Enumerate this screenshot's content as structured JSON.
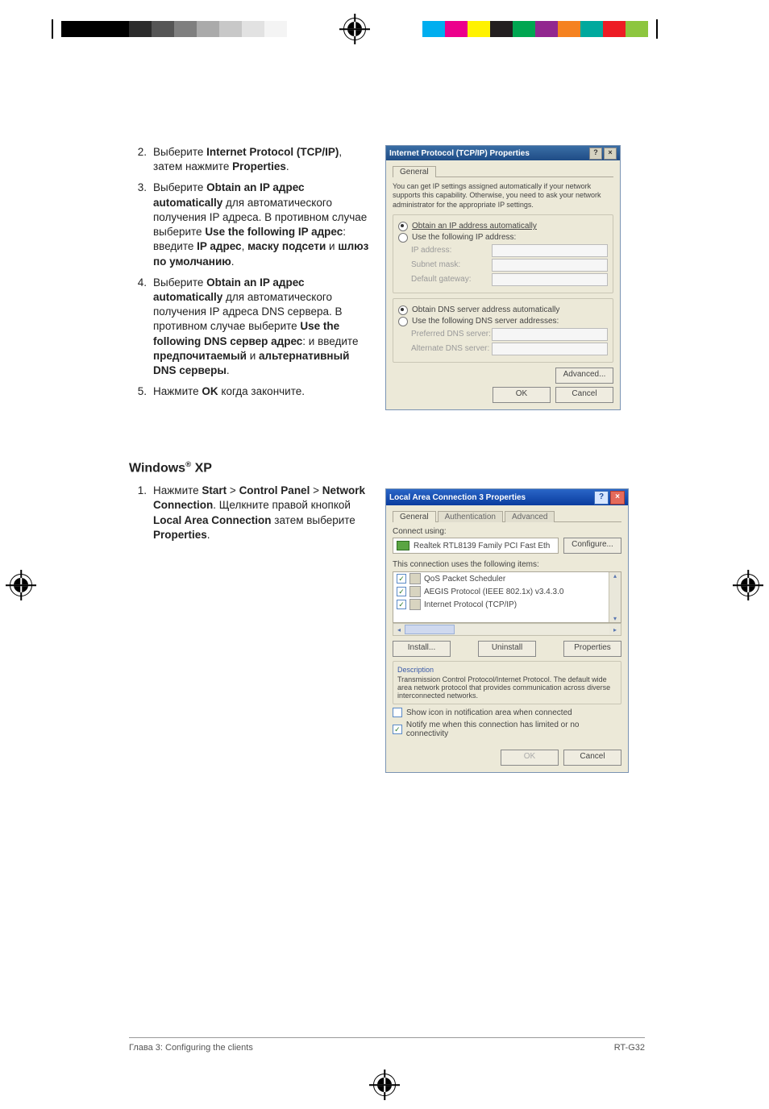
{
  "reg_colors_right": [
    "#00aeef",
    "#ec008c",
    "#fff200",
    "#231f20",
    "#00a651",
    "#92278f",
    "#f58220",
    "#00a99d",
    "#ed1c24",
    "#8dc63f"
  ],
  "reg_colors_left_count": 10,
  "steps_top": [
    {
      "num": "2.",
      "parts": [
        "Выберите ",
        [
          "b",
          "Internet Protocol (TCP/IP)"
        ],
        ", затем нажмите ",
        [
          "b",
          "Properties"
        ],
        "."
      ]
    },
    {
      "num": "3.",
      "parts": [
        "Выберите ",
        [
          "b",
          "Obtain an IP адрес automatically"
        ],
        " для автоматического получения IP адреса. В противном случае выберите ",
        [
          "b",
          "Use the following IP адрес"
        ],
        ": введите ",
        [
          "b",
          "IP адрес"
        ],
        ", ",
        [
          "b",
          "маску подсети"
        ],
        " и ",
        [
          "b",
          "шлюз по умолчанию"
        ],
        "."
      ]
    },
    {
      "num": "4.",
      "parts": [
        "Выберите ",
        [
          "b",
          "Obtain an IP адрес automatically"
        ],
        " для автоматического получения IP адреса DNS сервера. В противном случае выберите ",
        [
          "b",
          "Use the following DNS сервер адрес"
        ],
        ": и введите ",
        [
          "b",
          "предпочитаемый"
        ],
        " и ",
        [
          "b",
          "альтернативный DNS серверы"
        ],
        "."
      ]
    },
    {
      "num": "5.",
      "parts": [
        "Нажмите ",
        [
          "b",
          "OK"
        ],
        " когда закончите."
      ]
    }
  ],
  "section_heading_parts": [
    [
      "b",
      "Windows"
    ],
    [
      "sup",
      "®"
    ],
    [
      "b",
      " XP"
    ]
  ],
  "steps_bottom": [
    {
      "num": "1.",
      "parts": [
        "Нажмите ",
        [
          "b",
          "Start"
        ],
        " > ",
        [
          "b",
          "Control Panel"
        ],
        " > ",
        [
          "b",
          "Network Connection"
        ],
        ". Щелкните правой кнопкой ",
        [
          "b",
          "Local Area Connection"
        ],
        " затем выберите ",
        [
          "b",
          "Properties"
        ],
        "."
      ]
    }
  ],
  "dlg1": {
    "title": "Internet Protocol (TCP/IP) Properties",
    "help_btn": "?",
    "close_btn": "×",
    "tab": "General",
    "note": "You can get IP settings assigned automatically if your network supports this capability. Otherwise, you need to ask your network administrator for the appropriate IP settings.",
    "r1": "Obtain an IP address automatically",
    "r2": "Use the following IP address:",
    "f_ip": "IP address:",
    "f_mask": "Subnet mask:",
    "f_gw": "Default gateway:",
    "r3": "Obtain DNS server address automatically",
    "r4": "Use the following DNS server addresses:",
    "f_pdns": "Preferred DNS server:",
    "f_adns": "Alternate DNS server:",
    "btn_adv": "Advanced...",
    "btn_ok": "OK",
    "btn_cancel": "Cancel"
  },
  "dlg2": {
    "title": "Local Area Connection 3 Properties",
    "help_btn": "?",
    "close_btn": "×",
    "tabs": [
      "General",
      "Authentication",
      "Advanced"
    ],
    "connect_using": "Connect using:",
    "nic": "Realtek RTL8139 Family PCI Fast Eth",
    "btn_configure": "Configure...",
    "uses_items": "This connection uses the following items:",
    "items": [
      {
        "checked": true,
        "label": "QoS Packet Scheduler"
      },
      {
        "checked": true,
        "label": "AEGIS Protocol (IEEE 802.1x) v3.4.3.0"
      },
      {
        "checked": true,
        "label": "Internet Protocol (TCP/IP)"
      }
    ],
    "btn_install": "Install...",
    "btn_uninstall": "Uninstall",
    "btn_props": "Properties",
    "desc_label": "Description",
    "desc_text": "Transmission Control Protocol/Internet Protocol. The default wide area network protocol that provides communication across diverse interconnected networks.",
    "chk_show": "Show icon in notification area when connected",
    "chk_notify": "Notify me when this connection has limited or no connectivity",
    "btn_ok": "OK",
    "btn_cancel": "Cancel"
  },
  "footer": {
    "left": "Глава 3: Configuring the clients",
    "right": "RT-G32"
  }
}
